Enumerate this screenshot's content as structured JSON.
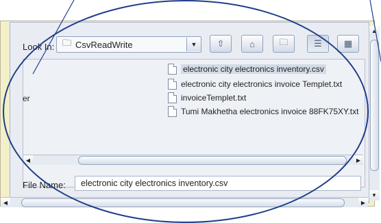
{
  "look_in": {
    "label": "Look In:",
    "value": "CsvReadWrite"
  },
  "toolbar": {
    "icons": [
      "up-one-level-icon",
      "home-icon",
      "new-folder-icon",
      "list-view-icon",
      "details-view-icon"
    ]
  },
  "left_cut_text": "er",
  "files": [
    {
      "name": "electronic city electronics inventory.csv",
      "selected": true
    },
    {
      "name": "electronic city electronics invoice Templet.txt",
      "selected": false
    },
    {
      "name": "invoiceTemplet.txt",
      "selected": false
    },
    {
      "name": "Tumi Makhetha electronics invoice 88FK75XY.txt",
      "selected": false
    }
  ],
  "file_name": {
    "label": "File Name:",
    "value": "electronic city electronics inventory.csv"
  },
  "annotation": {
    "color": "#1f3d8a"
  }
}
